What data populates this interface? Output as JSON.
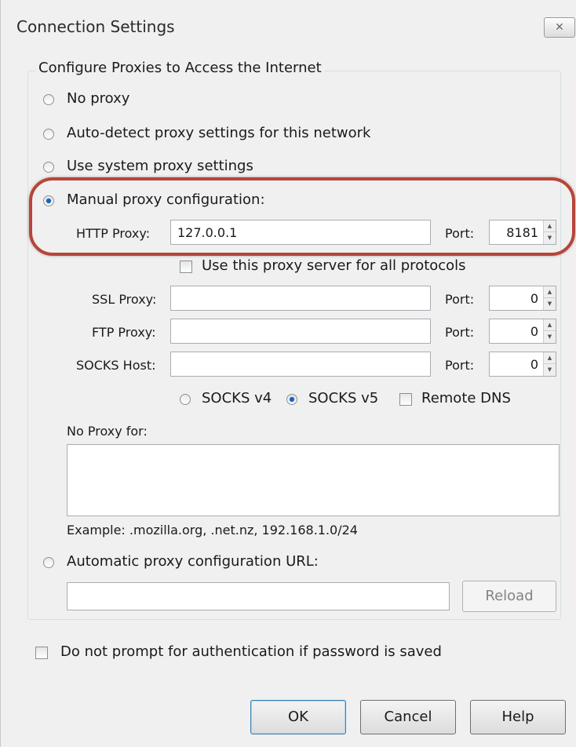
{
  "window": {
    "title": "Connection Settings",
    "close_glyph": "✕"
  },
  "group": {
    "title": "Configure Proxies to Access the Internet"
  },
  "options": {
    "no_proxy": "No proxy",
    "auto_detect": "Auto-detect proxy settings for this network",
    "system": "Use system proxy settings",
    "manual": "Manual proxy configuration:",
    "auto_url": "Automatic proxy configuration URL:",
    "selected": "manual"
  },
  "http": {
    "label": "HTTP Proxy:",
    "value": "127.0.0.1",
    "port_label": "Port:",
    "port": "8181"
  },
  "use_all_protocols": {
    "label": "Use this proxy server for all protocols",
    "checked": false
  },
  "ssl": {
    "label": "SSL Proxy:",
    "value": "",
    "port_label": "Port:",
    "port": "0"
  },
  "ftp": {
    "label": "FTP Proxy:",
    "value": "",
    "port_label": "Port:",
    "port": "0"
  },
  "socks": {
    "label": "SOCKS Host:",
    "value": "",
    "port_label": "Port:",
    "port": "0"
  },
  "socks_version": {
    "v4": "SOCKS v4",
    "v5": "SOCKS v5",
    "selected": "v5"
  },
  "remote_dns": {
    "label": "Remote DNS",
    "checked": false
  },
  "no_proxy_for": {
    "label": "No Proxy for:",
    "value": "",
    "example": "Example: .mozilla.org, .net.nz, 192.168.1.0/24"
  },
  "auto_url": {
    "value": "",
    "reload": "Reload"
  },
  "auth": {
    "label": "Do not prompt for authentication if password is saved",
    "checked": false
  },
  "buttons": {
    "ok": "OK",
    "cancel": "Cancel",
    "help": "Help"
  },
  "colors": {
    "highlight": "#b6453a",
    "radio_selected": "#1a5fb4"
  },
  "icons": {
    "spin_up": "▲",
    "spin_down": "▼"
  }
}
